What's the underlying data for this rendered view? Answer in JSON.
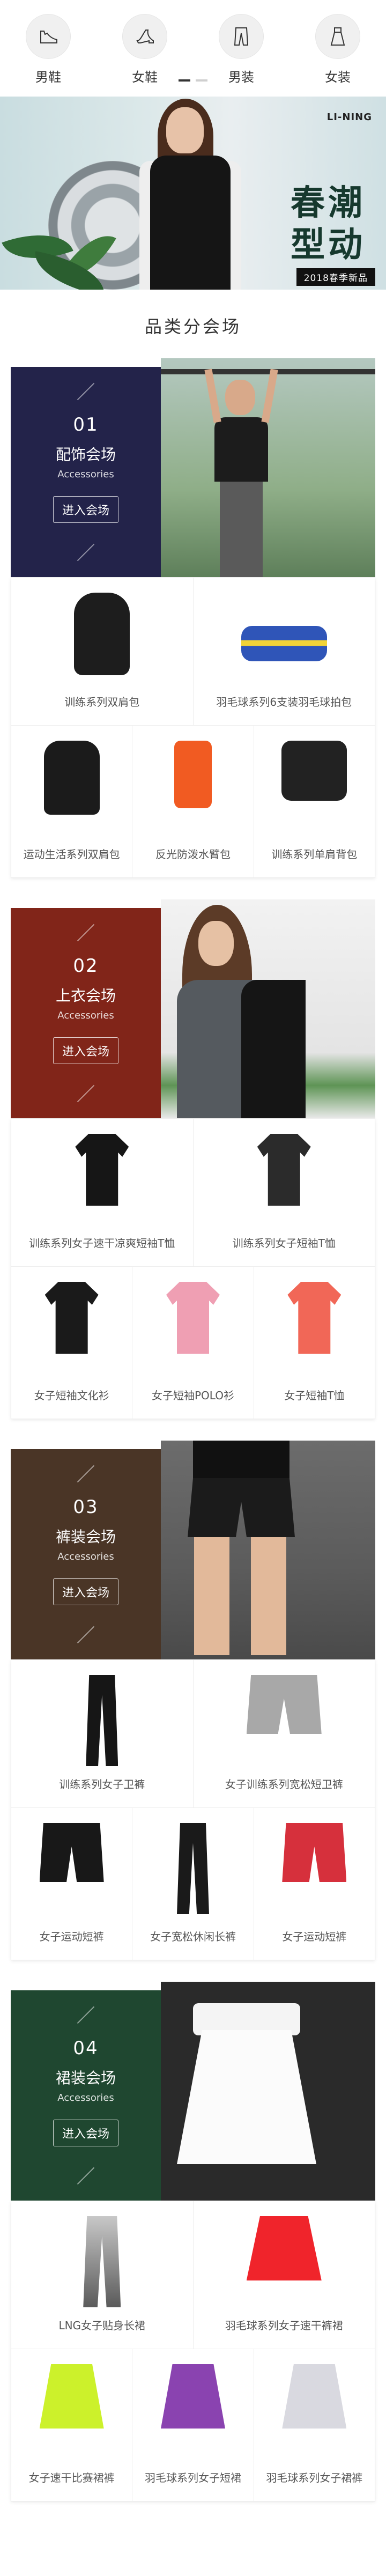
{
  "nav": {
    "items": [
      {
        "label": "男鞋",
        "icon": "mens-shoe-icon"
      },
      {
        "label": "女鞋",
        "icon": "high-heel-icon"
      },
      {
        "label": "男装",
        "icon": "mens-trousers-icon"
      },
      {
        "label": "女装",
        "icon": "dress-icon"
      }
    ],
    "pager": {
      "active": 1,
      "total": 2
    }
  },
  "hero": {
    "brand": "LI-NING",
    "slogan_line1": "春潮",
    "slogan_line2": "型动",
    "tag": "2018春季新品"
  },
  "section_title": "品类分会场",
  "categories": [
    {
      "num": "02",
      "name": "上衣会场",
      "en": "Accessories",
      "enter": "进入会场",
      "color": "#812519",
      "products_top": [
        {
          "name": "训练系列女子速干凉爽短袖T恤",
          "color": "#161616"
        },
        {
          "name": "训练系列女子短袖T恤",
          "color": "#2b2b2b"
        }
      ],
      "products_bottom": [
        {
          "name": "女子短袖文化衫",
          "color": "#1a1a1a"
        },
        {
          "name": "女子短袖POLO衫",
          "color": "#ef9fb3"
        },
        {
          "name": "女子短袖T恤",
          "color": "#f16757"
        }
      ]
    }
  ],
  "cat1": {
    "num": "01",
    "name": "配饰会场",
    "en": "Accessories",
    "enter": "进入会场",
    "color": "#23234a",
    "products_top": [
      {
        "name": "训练系列双肩包"
      },
      {
        "name": "羽毛球系列6支装羽毛球拍包"
      }
    ],
    "products_bottom": [
      {
        "name": "运动生活系列双肩包"
      },
      {
        "name": "反光防泼水臂包"
      },
      {
        "name": "训练系列单肩背包"
      }
    ]
  },
  "cat2": {
    "num": "02",
    "name": "上衣会场",
    "en": "Accessories",
    "enter": "进入会场",
    "color": "#812519",
    "products_top": [
      {
        "name": "训练系列女子速干凉爽短袖T恤"
      },
      {
        "name": "训练系列女子短袖T恤"
      }
    ],
    "products_bottom": [
      {
        "name": "女子短袖文化衫"
      },
      {
        "name": "女子短袖POLO衫"
      },
      {
        "name": "女子短袖T恤"
      }
    ]
  },
  "cat3": {
    "num": "03",
    "name": "裤装会场",
    "en": "Accessories",
    "enter": "进入会场",
    "color": "#4a3526",
    "products_top": [
      {
        "name": "训练系列女子卫裤"
      },
      {
        "name": "女子训练系列宽松短卫裤"
      }
    ],
    "products_bottom": [
      {
        "name": "女子运动短裤"
      },
      {
        "name": "女子宽松休闲长裤"
      },
      {
        "name": "女子运动短裤"
      }
    ]
  },
  "cat4": {
    "num": "04",
    "name": "裙装会场",
    "en": "Accessories",
    "enter": "进入会场",
    "color": "#1f4730",
    "products_top": [
      {
        "name": "LNG女子贴身长裙"
      },
      {
        "name": "羽毛球系列女子速干裤裙"
      }
    ],
    "products_bottom": [
      {
        "name": "女子速干比赛裙裤"
      },
      {
        "name": "羽毛球系列女子短裙"
      },
      {
        "name": "羽毛球系列女子裙裤"
      }
    ]
  }
}
